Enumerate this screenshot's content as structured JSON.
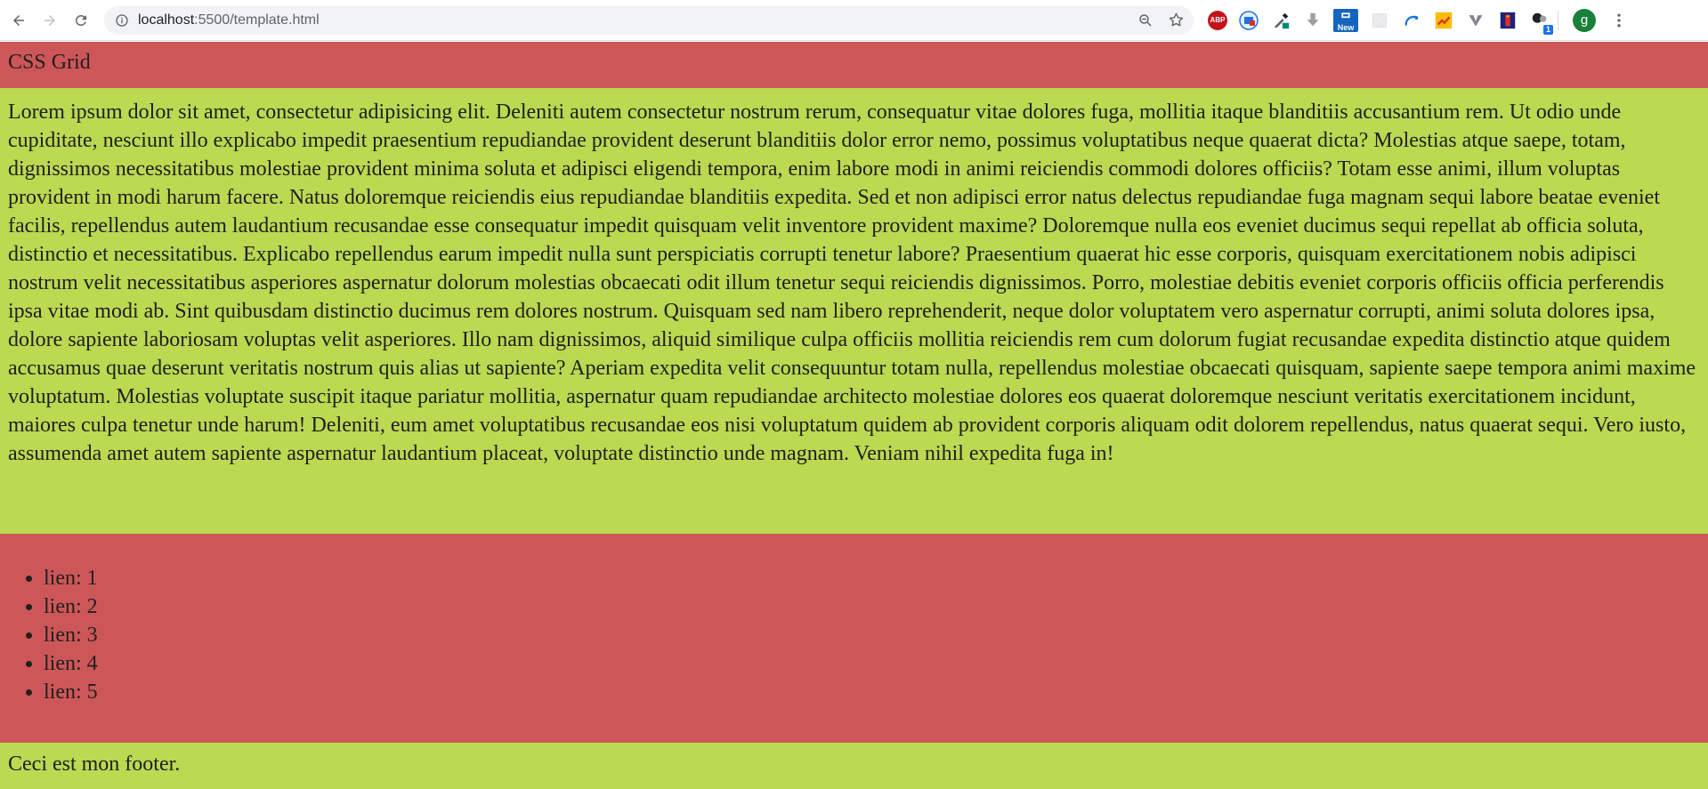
{
  "browser": {
    "url_host": "localhost",
    "url_path": ":5500/template.html",
    "extensions": [
      "abp-icon",
      "screen-capture-icon",
      "eyedropper-icon",
      "download-icon",
      "new-icon",
      "blank-ext-icon",
      "curve-icon",
      "chart-icon",
      "v-icon",
      "flag-icon",
      "shapes-icon"
    ],
    "abp_label": "ABP",
    "new_badge": "New",
    "count_badge": "1",
    "profile_initial": "g"
  },
  "page": {
    "header_title": "CSS Grid",
    "main_text": "Lorem ipsum dolor sit amet, consectetur adipisicing elit. Deleniti autem consectetur nostrum rerum, consequatur vitae dolores fuga, mollitia itaque blanditiis accusantium rem. Ut odio unde cupiditate, nesciunt illo explicabo impedit praesentium repudiandae provident deserunt blanditiis dolor error nemo, possimus voluptatibus neque quaerat dicta? Molestias atque saepe, totam, dignissimos necessitatibus molestiae provident minima soluta et adipisci eligendi tempora, enim labore modi in animi reiciendis commodi dolores officiis? Totam esse animi, illum voluptas provident in modi harum facere. Natus doloremque reiciendis eius repudiandae blanditiis expedita. Sed et non adipisci error natus delectus repudiandae fuga magnam sequi labore beatae eveniet facilis, repellendus autem laudantium recusandae esse consequatur impedit quisquam velit inventore provident maxime? Doloremque nulla eos eveniet ducimus sequi repellat ab officia soluta, distinctio et necessitatibus. Explicabo repellendus earum impedit nulla sunt perspiciatis corrupti tenetur labore? Praesentium quaerat hic esse corporis, quisquam exercitationem nobis adipisci nostrum velit necessitatibus asperiores aspernatur dolorum molestias obcaecati odit illum tenetur sequi reiciendis dignissimos. Porro, molestiae debitis eveniet corporis officiis officia perferendis ipsa vitae modi ab. Sint quibusdam distinctio ducimus rem dolores nostrum. Quisquam sed nam libero reprehenderit, neque dolor voluptatem vero aspernatur corrupti, animi soluta dolores ipsa, dolore sapiente laboriosam voluptas velit asperiores. Illo nam dignissimos, aliquid similique culpa officiis mollitia reiciendis rem cum dolorum fugiat recusandae expedita distinctio atque quidem accusamus quae deserunt veritatis nostrum quis alias ut sapiente? Aperiam expedita velit consequuntur totam nulla, repellendus molestiae obcaecati quisquam, sapiente saepe tempora animi maxime voluptatum. Molestias voluptate suscipit itaque pariatur mollitia, aspernatur quam repudiandae architecto molestiae dolores eos quaerat doloremque nesciunt veritatis exercitationem incidunt, maiores culpa tenetur unde harum! Deleniti, eum amet voluptatibus recusandae eos nisi voluptatum quidem ab provident corporis aliquam odit dolorem repellendus, natus quaerat sequi. Vero iusto, assumenda amet autem sapiente aspernatur laudantium placeat, voluptate distinctio unde magnam. Veniam nihil expedita fuga in!",
    "links": [
      "lien: 1",
      "lien: 2",
      "lien: 3",
      "lien: 4",
      "lien: 5"
    ],
    "footer_text": "Ceci est mon footer."
  },
  "colors": {
    "red_section": "#cd5758",
    "green_section": "#bcd952"
  }
}
